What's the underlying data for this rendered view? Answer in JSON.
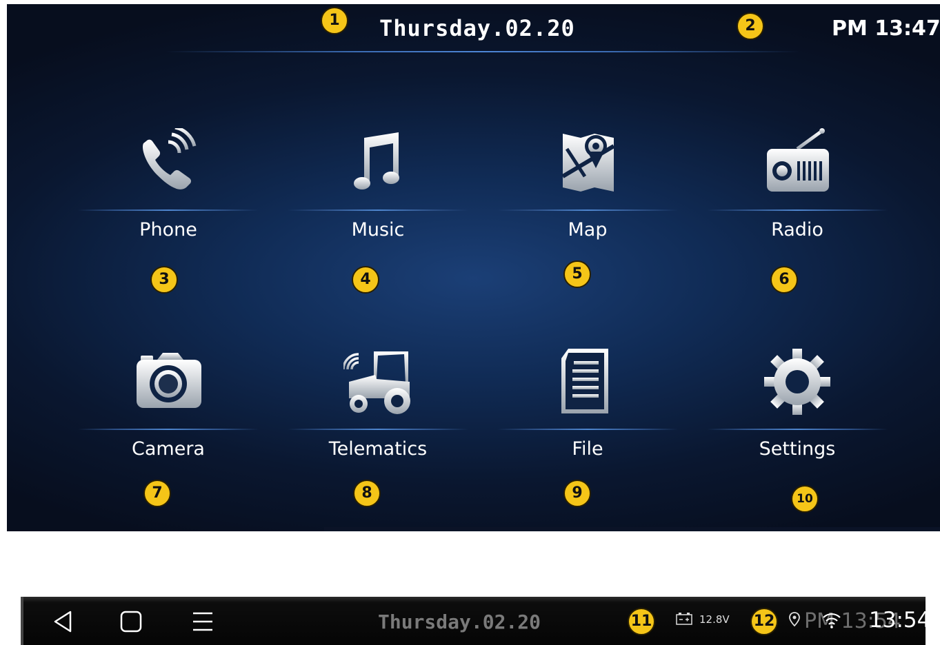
{
  "header": {
    "date": "Thursday.02.20",
    "time": "PM 13:47"
  },
  "apps": [
    {
      "label": "Phone",
      "icon": "phone-icon",
      "badge": "3"
    },
    {
      "label": "Music",
      "icon": "music-note-icon",
      "badge": "4"
    },
    {
      "label": "Map",
      "icon": "map-icon",
      "badge": "5"
    },
    {
      "label": "Radio",
      "icon": "radio-icon",
      "badge": "6"
    },
    {
      "label": "Camera",
      "icon": "camera-icon",
      "badge": "7"
    },
    {
      "label": "Telematics",
      "icon": "tractor-icon",
      "badge": "8"
    },
    {
      "label": "File",
      "icon": "file-icon",
      "badge": "9"
    },
    {
      "label": "Settings",
      "icon": "gear-icon",
      "badge": "10"
    }
  ],
  "callouts": {
    "date": "1",
    "time": "2",
    "battery": "11",
    "status": "12"
  },
  "navbar": {
    "date": "Thursday.02.20",
    "battery": "12.8V",
    "time": "13:54",
    "time_ghost": "PM 13:54"
  },
  "colors": {
    "badge": "#f5c518",
    "accent": "#4f86cf"
  }
}
